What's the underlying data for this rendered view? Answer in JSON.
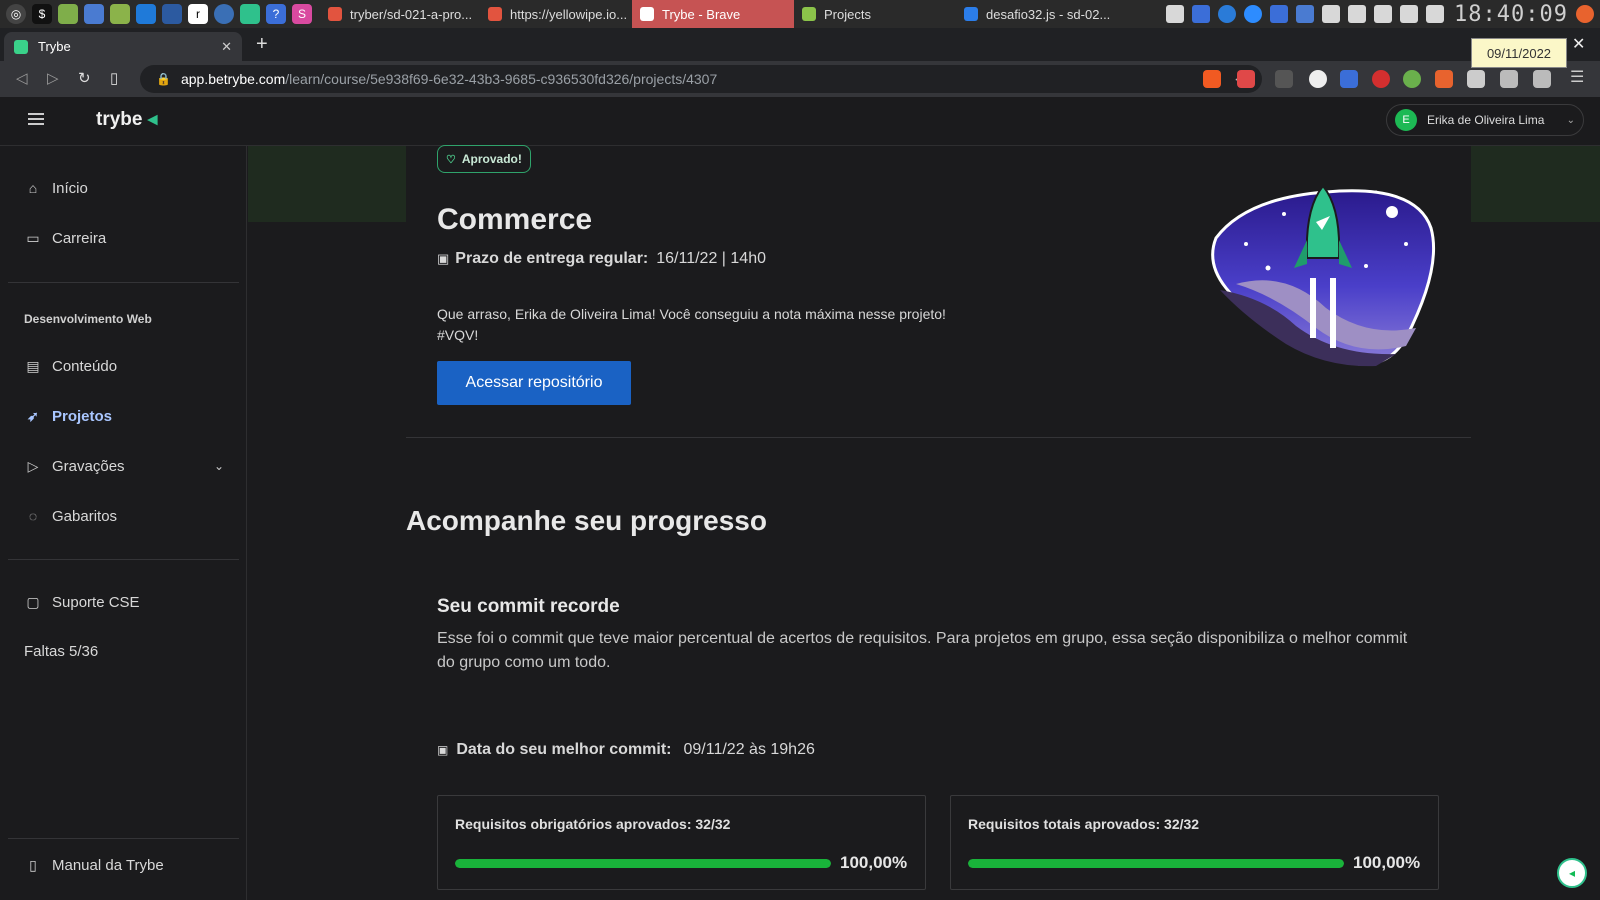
{
  "taskbar": {
    "tasks": [
      {
        "label": "tryber/sd-021-a-pro...",
        "color": "#e2543f"
      },
      {
        "label": "https://yellowipe.io...",
        "color": "#e2543f"
      },
      {
        "label": "Trybe - Brave",
        "color": "#e2543f"
      },
      {
        "label": "Projects",
        "color": "#8bc34a"
      },
      {
        "label": "desafio32.js - sd-02...",
        "color": "#2b7de9"
      }
    ],
    "clock": "18:40:09",
    "tooltip": "09/11/2022"
  },
  "browser": {
    "tab_title": "Trybe",
    "tab_close": "✕",
    "new_tab": "+",
    "window_close": "✕",
    "url_host": "app.betrybe.com",
    "url_path": "/learn/course/5e938f69-6e32-43b3-9685-c936530fd326/projects/4307"
  },
  "header": {
    "logo": "trybe",
    "user_initial": "E",
    "user_name": "Erika de Oliveira Lima"
  },
  "sidebar": {
    "items": [
      {
        "label": "Início",
        "icon": "home-icon"
      },
      {
        "label": "Carreira",
        "icon": "briefcase-icon"
      },
      {
        "label": "Conteúdo",
        "icon": "book-icon"
      },
      {
        "label": "Projetos",
        "icon": "rocket-icon"
      },
      {
        "label": "Gravações",
        "icon": "play-icon"
      },
      {
        "label": "Gabaritos",
        "icon": "lightbulb-icon"
      },
      {
        "label": "Suporte CSE",
        "icon": "chat-icon"
      }
    ],
    "section_title": "Desenvolvimento Web",
    "absences": "Faltas 5/36",
    "manual": "Manual da Trybe"
  },
  "project": {
    "status_badge": "Aprovado!",
    "title": "Commerce",
    "deadline_label": "Prazo de entrega regular:",
    "deadline_value": "16/11/22 | 14h0",
    "congrats_line1": "Que arraso, Erika de Oliveira Lima! Você conseguiu a nota máxima nesse projeto!",
    "congrats_line2": "#VQV!",
    "repo_button": "Acessar repositório"
  },
  "progress": {
    "title": "Acompanhe seu progresso",
    "commit_title": "Seu commit recorde",
    "commit_desc": "Esse foi o commit que teve maior percentual de acertos de requisitos. Para projetos em grupo, essa seção disponibiliza o melhor commit do grupo como um todo.",
    "best_commit_label": "Data do seu melhor commit:",
    "best_commit_value": "09/11/22 às 19h26",
    "cards": [
      {
        "title": "Requisitos obrigatórios aprovados: 32/32",
        "percent_label": "100,00%",
        "fill": 1.0
      },
      {
        "title": "Requisitos totais aprovados: 32/32",
        "percent_label": "100,00%",
        "fill": 1.0
      }
    ]
  },
  "colors": {
    "accent": "#2fc18c",
    "primary_button": "#1a62c4",
    "progress_fill": "#19b33a",
    "active_nav": "#a9c6ff"
  }
}
